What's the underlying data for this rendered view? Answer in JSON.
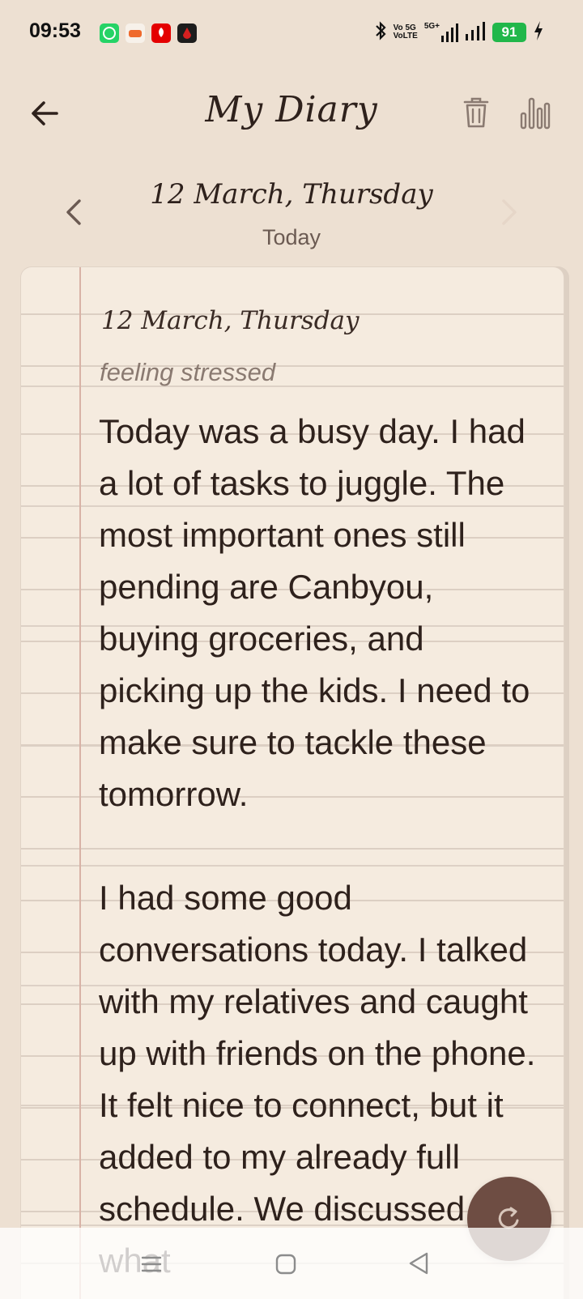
{
  "status_bar": {
    "time": "09:53",
    "app_icons": [
      {
        "name": "whatsapp-icon",
        "color": "#25d366"
      },
      {
        "name": "games-icon",
        "color": "#f7f1ea"
      },
      {
        "name": "airtel-icon",
        "color": "#e40000"
      },
      {
        "name": "app-icon-dark",
        "color": "#1d1d1d"
      }
    ],
    "network_line1": "Vo 5G",
    "network_line2": "VoLTE",
    "net_type": "5G+",
    "battery_level": "91"
  },
  "toolbar": {
    "title": "My Diary",
    "back_icon": "arrow-left-icon",
    "trash_icon": "trash-icon",
    "stats_icon": "bar-chart-icon"
  },
  "date_nav": {
    "date": "12 March, Thursday",
    "subtitle": "Today"
  },
  "entry": {
    "date": "12 March, Thursday",
    "mood": "feeling stressed",
    "paragraphs": [
      "Today was a busy day. I had a lot of tasks to juggle. The most important ones still pending are Canbyou, buying groceries, and picking up the kids. I need to make sure to tackle these tomorrow.",
      "I had some good conversations today. I talked with my relatives and caught up with friends on the phone. It felt nice to connect, but it added to my already full schedule. We discussed what"
    ]
  },
  "fab": {
    "icon": "refresh-icon"
  },
  "colors": {
    "background": "#ede0d2",
    "paper": "#f5ebdf",
    "accent": "#6e4d43",
    "margin_line": "#d8b2a6"
  }
}
